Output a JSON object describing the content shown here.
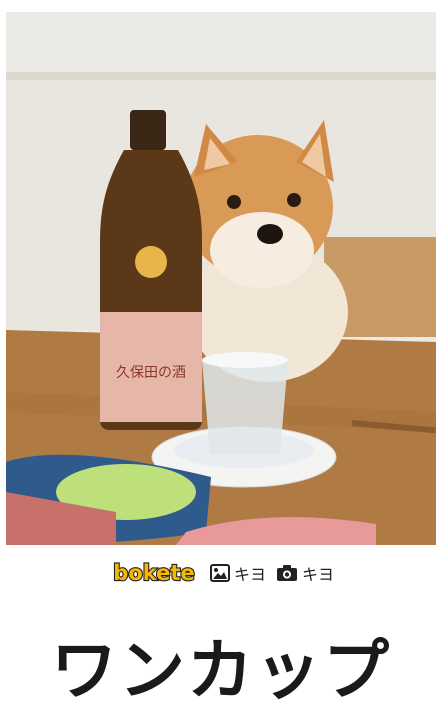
{
  "photo": {
    "description_icon": "shiba-inu-with-sake-photo",
    "bottle_label_text": "久保田の酒"
  },
  "credits": {
    "logo_text": "bokete",
    "image_author_icon": "image-icon",
    "image_author": "キヨ",
    "photo_author_icon": "camera-icon",
    "photo_author": "キヨ"
  },
  "caption": {
    "text": "ワンカップ"
  },
  "colors": {
    "logo_fill": "#f5b800",
    "logo_outline": "#222222",
    "caption": "#1a1a1a"
  }
}
